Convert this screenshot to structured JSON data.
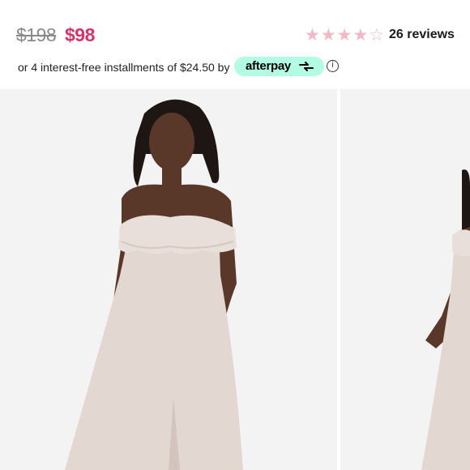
{
  "product": {
    "original_price": "$198",
    "sale_price": "$98",
    "rating": 4,
    "rating_max": 5,
    "reviews_label": "26 reviews"
  },
  "afterpay": {
    "text": "or 4 interest-free installments of $24.50 by",
    "logo_text": "afterpay",
    "badge_color": "#b2fce4",
    "info_icon": "info-icon"
  },
  "colors": {
    "sale": "#d6336c",
    "star": "#f3b8c6"
  },
  "gallery": {
    "images": [
      {
        "alt": "Model wearing blush off-the-shoulder ruffle maxi dress, front view"
      },
      {
        "alt": "Model wearing blush off-the-shoulder ruffle maxi dress, side view"
      }
    ]
  }
}
